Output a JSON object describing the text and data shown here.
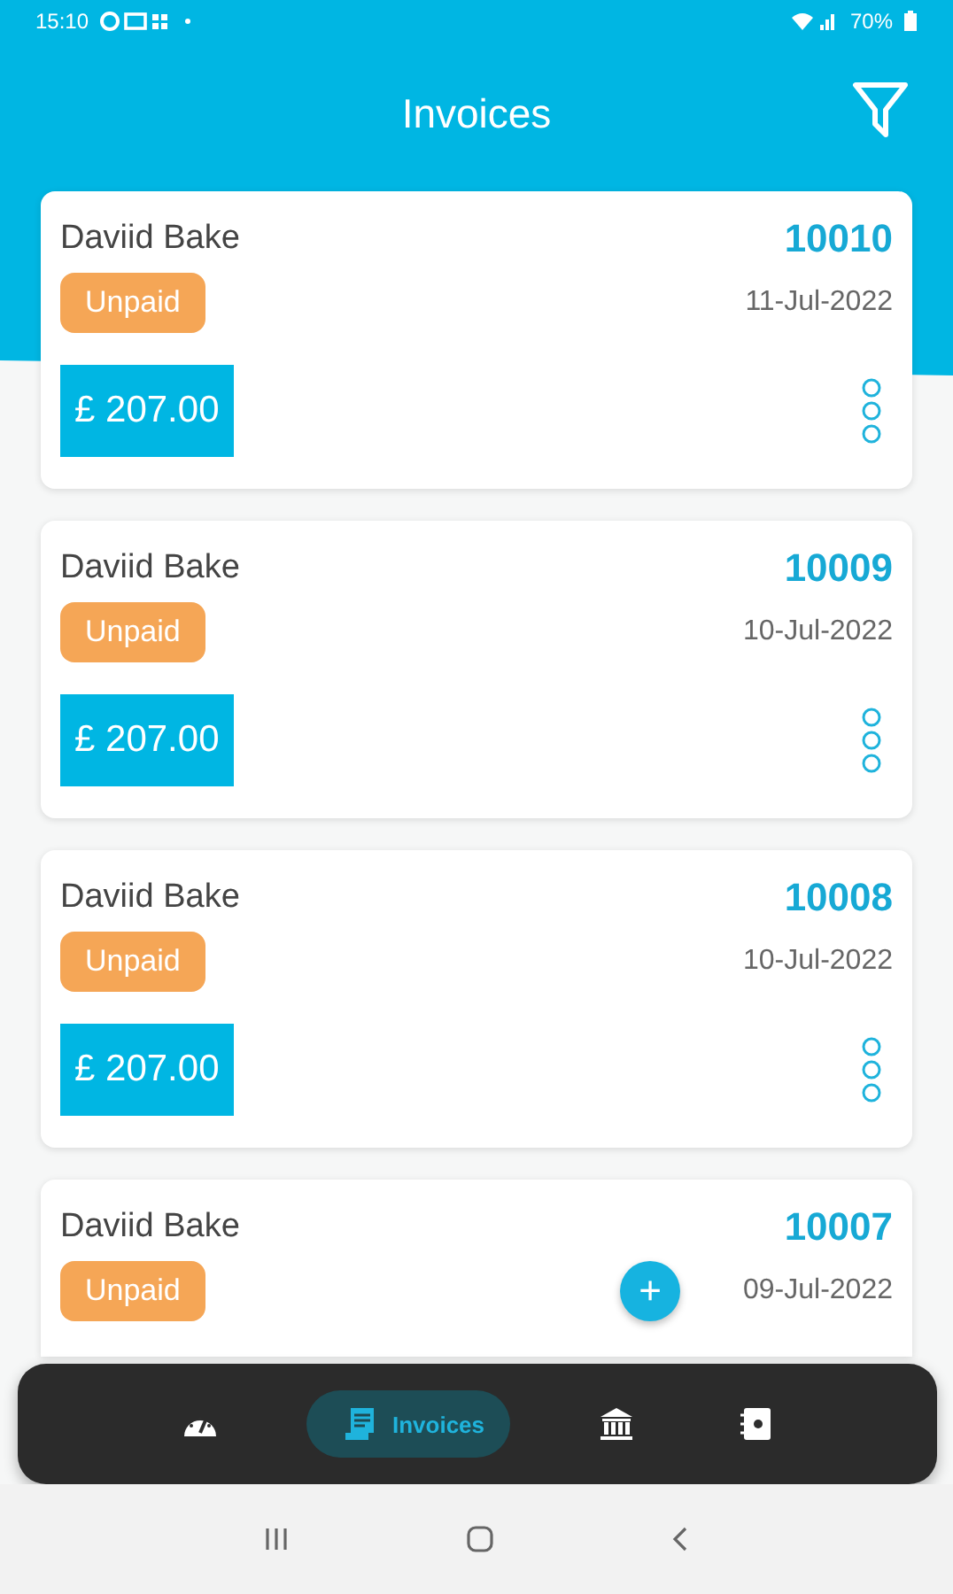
{
  "status_bar": {
    "time": "15:10",
    "battery": "70%"
  },
  "header": {
    "title": "Invoices"
  },
  "invoices": [
    {
      "customer": "Daviid Bake",
      "number": "10010",
      "status": "Unpaid",
      "date": "11-Jul-2022",
      "amount": "£ 207.00"
    },
    {
      "customer": "Daviid Bake",
      "number": "10009",
      "status": "Unpaid",
      "date": "10-Jul-2022",
      "amount": "£ 207.00"
    },
    {
      "customer": "Daviid Bake",
      "number": "10008",
      "status": "Unpaid",
      "date": "10-Jul-2022",
      "amount": "£ 207.00"
    },
    {
      "customer": "Daviid Bake",
      "number": "10007",
      "status": "Unpaid",
      "date": "09-Jul-2022"
    }
  ],
  "add_button": {
    "label": "+"
  },
  "bottom_nav": [
    {
      "selected": false
    },
    {
      "label": "Invoices",
      "selected": true
    },
    {
      "selected": false
    },
    {
      "selected": false
    }
  ]
}
